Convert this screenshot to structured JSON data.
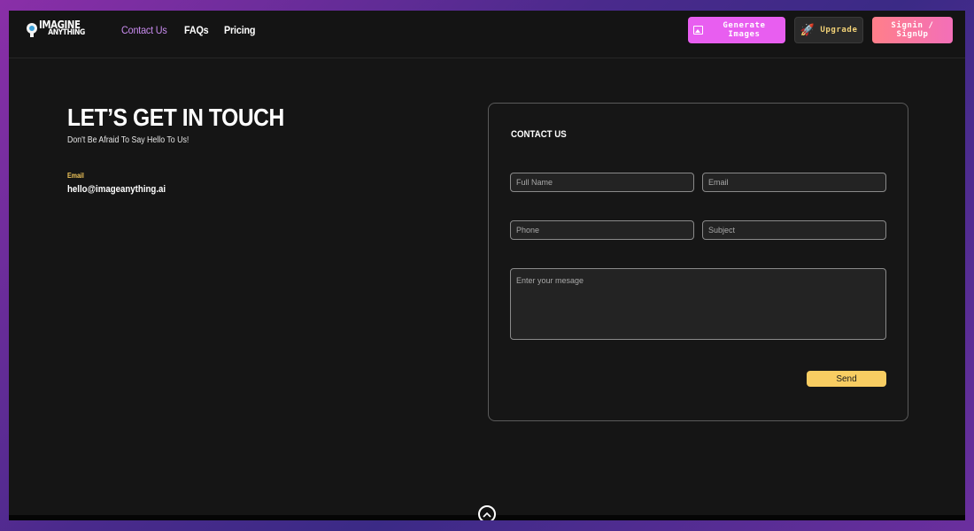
{
  "brand": {
    "line1": "IMAGINE",
    "line2": "ANYTHING"
  },
  "nav": {
    "links": [
      {
        "label": "Contact Us",
        "active": true
      },
      {
        "label": "FAQs",
        "active": false
      },
      {
        "label": "Pricing",
        "active": false
      }
    ],
    "generate_label": "Generate Images",
    "upgrade_label": "Upgrade",
    "signin_label": "Signin / SignUp"
  },
  "hero": {
    "title": "LET’S GET IN TOUCH",
    "subtitle": "Don't Be Afraid To Say Hello To Us!",
    "email_label": "Email",
    "email_value": "hello@imageanything.ai"
  },
  "form": {
    "title": "CONTACT US",
    "full_name_placeholder": "Full Name",
    "email_placeholder": "Email",
    "phone_placeholder": "Phone",
    "subject_placeholder": "Subject",
    "message_placeholder": "Enter your mesage",
    "send_label": "Send"
  },
  "colors": {
    "accent_pink": "#e85ef0",
    "accent_yellow": "#f8cd62",
    "active_link": "#c98cf0",
    "background": "#151515"
  },
  "icons": {
    "generate": "image-icon",
    "upgrade": "rocket-icon",
    "scroll_top": "chevron-up-icon"
  }
}
